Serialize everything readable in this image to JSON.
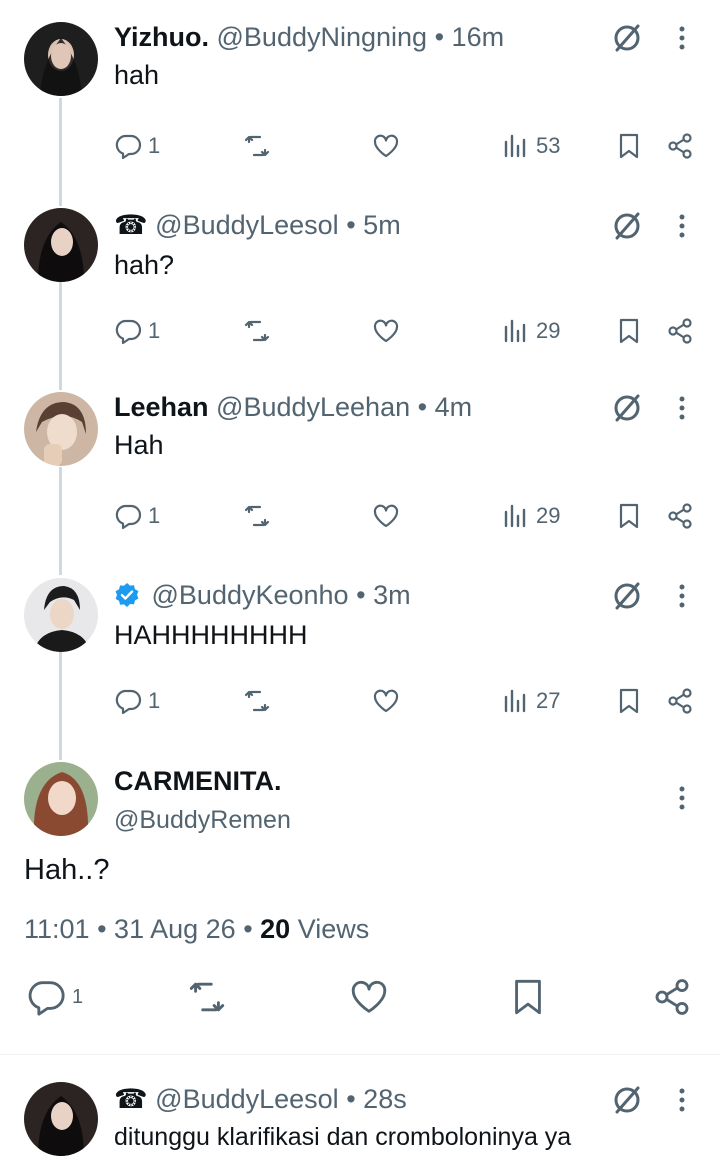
{
  "replies_above": [
    {
      "name": "Yizhuo.",
      "handle": "@BuddyNingning",
      "time": "16m",
      "text": "hah",
      "replies": "1",
      "views": "53",
      "avatar_color": "#2a2a2a"
    },
    {
      "name": "☎",
      "handle": "@BuddyLeesol",
      "time": "5m",
      "text": "hah?",
      "replies": "1",
      "views": "29",
      "avatar_color": "#3a2f2c"
    },
    {
      "name": "Leehan",
      "handle": "@BuddyLeehan",
      "time": "4m",
      "text": "Hah",
      "replies": "1",
      "views": "29",
      "avatar_color": "#b89a82"
    },
    {
      "name": "",
      "handle": "@BuddyKeonho",
      "time": "3m",
      "text": "HAHHHHHHHH",
      "replies": "1",
      "views": "27",
      "avatar_color": "#404550"
    }
  ],
  "main_tweet": {
    "name": "CARMENITA.",
    "handle": "@BuddyRemen",
    "text": "Hah..?",
    "time": "11:01",
    "date": "31 Aug 26",
    "views_count": "20",
    "views_label": "Views",
    "replies": "1",
    "avatar_color": "#c98a66"
  },
  "reply_below": {
    "name": "☎",
    "handle": "@BuddyLeesol",
    "time": "28s",
    "text": "ditunggu klarifikasi dan crombolonin‌ya ya",
    "avatar_color": "#3a2f2c"
  },
  "separator": "•",
  "colors": {
    "muted": "#536471",
    "text": "#0f1419",
    "verified": "#1d9bf0",
    "thread_line": "#cfd9de"
  },
  "icons": [
    "reply-icon",
    "retweet-icon",
    "like-icon",
    "views-icon",
    "bookmark-icon",
    "share-icon",
    "grok-icon",
    "more-icon",
    "verified-icon"
  ]
}
